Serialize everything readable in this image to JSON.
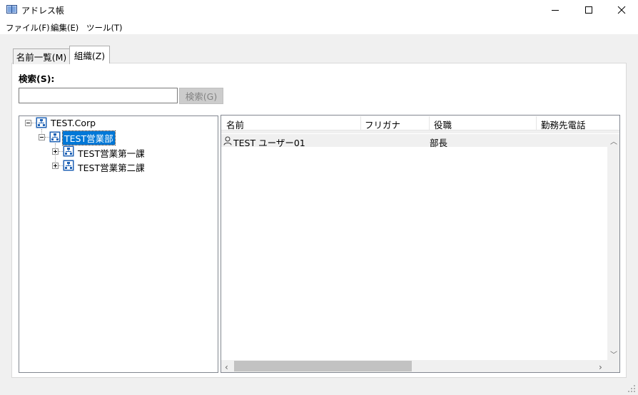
{
  "window": {
    "title": "アドレス帳",
    "minimize_icon": "minimize-icon",
    "maximize_icon": "maximize-icon",
    "close_icon": "close-icon"
  },
  "menu": [
    "ファイル(F)",
    "編集(E)",
    "ツール(T)"
  ],
  "tabs": [
    {
      "label": "名前一覧(M)",
      "selected": false
    },
    {
      "label": "組織(Z)",
      "selected": true
    }
  ],
  "search": {
    "label": "検索(S):",
    "value": "",
    "button_label": "検索(G)",
    "button_enabled": false
  },
  "tree": {
    "root": {
      "label": "TEST.Corp",
      "expanded": true
    },
    "dept": {
      "label": "TEST営業部",
      "expanded": true,
      "selected": true
    },
    "children": [
      {
        "label": "TEST営業第一課",
        "expanded": false
      },
      {
        "label": "TEST営業第二課",
        "expanded": false
      }
    ]
  },
  "list": {
    "columns": [
      "名前",
      "フリガナ",
      "役職",
      "勤務先電話"
    ],
    "rows": [
      {
        "icon": "user-icon",
        "name": "TEST ユーザー01",
        "furigana": "",
        "title": "部長",
        "phone": ""
      }
    ]
  },
  "colors": {
    "selection": "#0078d7",
    "org_icon": "#1f62b5"
  }
}
